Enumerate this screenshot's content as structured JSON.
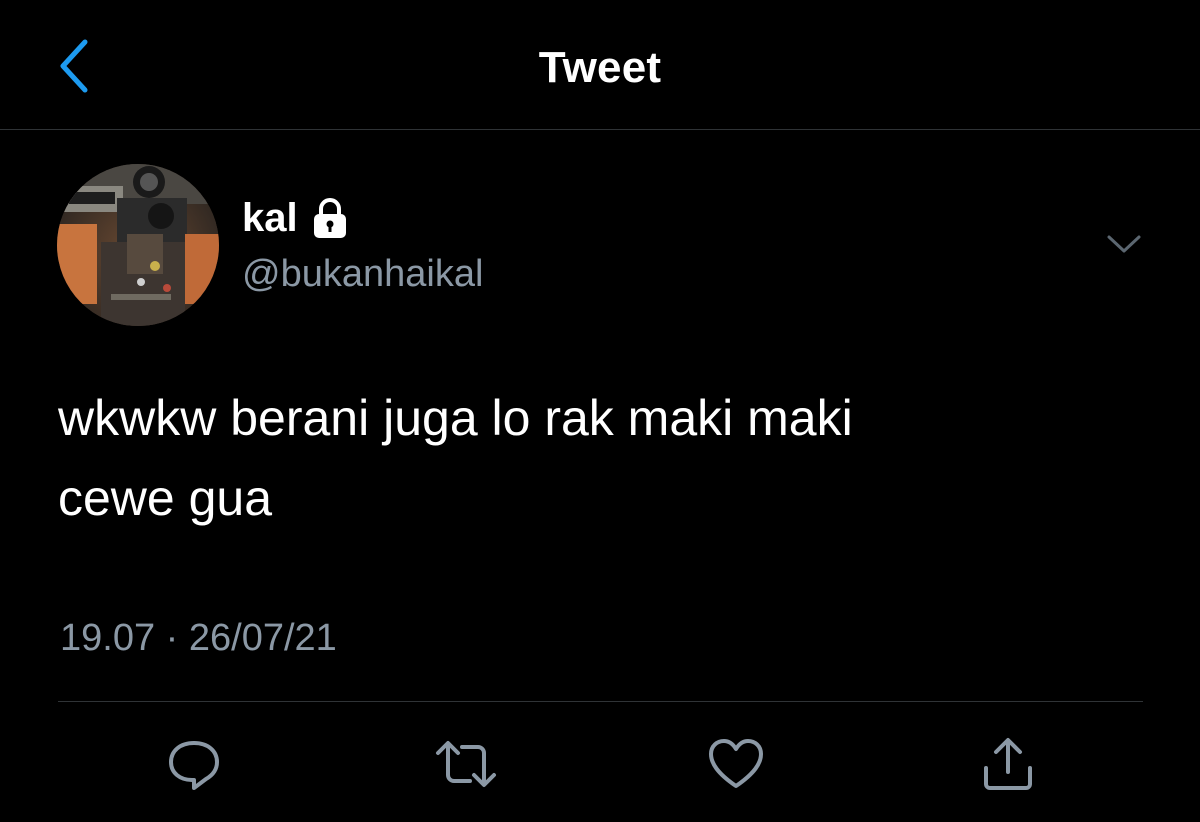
{
  "header": {
    "title": "Tweet",
    "back_icon": "chevron-left-icon",
    "accent_color": "#1d9bf0"
  },
  "author": {
    "display_name": "kal",
    "handle": "@bukanhaikal",
    "protected_icon": "lock-icon",
    "menu_icon": "chevron-down-icon"
  },
  "tweet": {
    "text": "wkwkw berani juga lo rak maki maki\ncewe gua",
    "timestamp": "19.07 · 26/07/21"
  },
  "actions": [
    {
      "name": "reply",
      "icon": "reply-icon"
    },
    {
      "name": "retweet",
      "icon": "retweet-icon"
    },
    {
      "name": "like",
      "icon": "heart-icon"
    },
    {
      "name": "share",
      "icon": "share-icon"
    }
  ],
  "colors": {
    "background": "#000000",
    "text_primary": "#ffffff",
    "text_secondary": "#8b98a5",
    "divider": "#2f3336"
  }
}
